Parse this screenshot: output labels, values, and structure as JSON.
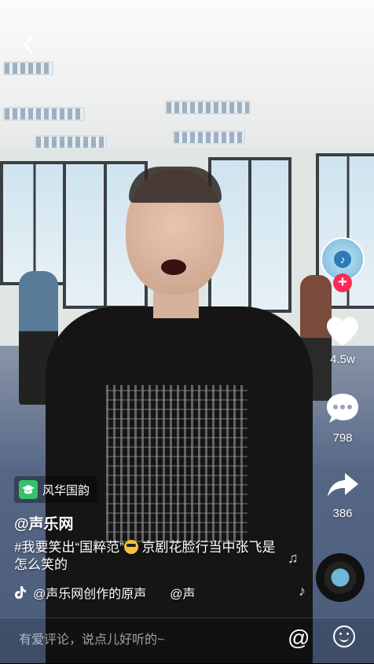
{
  "video": {
    "tag_label": "风华国韵",
    "author": "@声乐网",
    "caption": "#我要笑出“国粹范”😎 京剧花脸行当中张飞是怎么笑的",
    "caption_part1": "#我要笑出“国粹范”",
    "caption_part2": " 京剧花脸行当中张飞是怎么笑的",
    "music_text": "@声乐网创作的原声",
    "music_text_2": "@声"
  },
  "rail": {
    "like_count": "4.5w",
    "comment_count": "798",
    "share_count": "386"
  },
  "comment_bar": {
    "placeholder": "有爱评论，说点儿好听的~",
    "at_symbol": "@"
  },
  "colors": {
    "accent": "#fe2c55",
    "tag_green": "#35c26b"
  },
  "icons": {
    "back": "back-arrow-icon",
    "like": "heart-icon",
    "comment": "speech-bubble-icon",
    "share": "share-arrow-icon",
    "music": "tiktok-note-icon",
    "emoji": "smile-icon"
  }
}
